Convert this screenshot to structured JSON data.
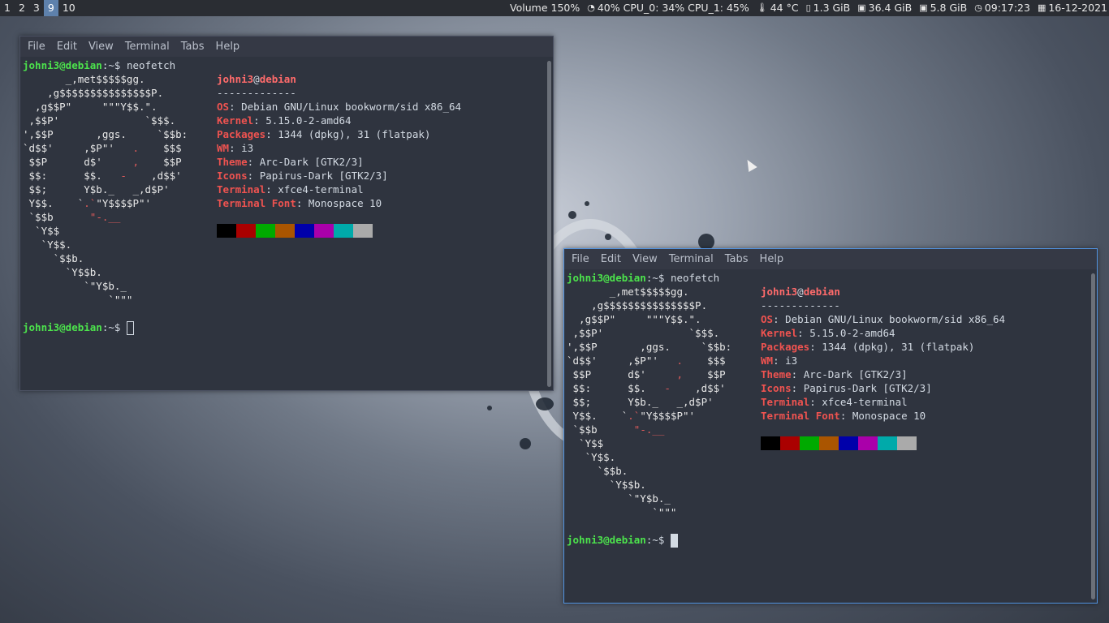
{
  "topbar": {
    "workspaces": [
      {
        "label": "1",
        "active": false
      },
      {
        "label": "2",
        "active": false
      },
      {
        "label": "3",
        "active": false
      },
      {
        "label": "9",
        "active": true
      },
      {
        "label": "10",
        "active": false
      }
    ],
    "volume": "Volume 150%",
    "cpu": "40% CPU_0: 34% CPU_1: 45%",
    "temp": "44 °C",
    "mem": "1.3 GiB",
    "disk1": "36.4 GiB",
    "disk2": "5.8 GiB",
    "time": "09:17:23",
    "date": "16-12-2021"
  },
  "terminal": {
    "menu": [
      "File",
      "Edit",
      "View",
      "Terminal",
      "Tabs",
      "Help"
    ],
    "user": "johni3@debian",
    "path_prompt": ":~$ ",
    "command": "neofetch",
    "header_user": "johni3",
    "header_at": "@",
    "header_host": "debian",
    "separator": "-------------",
    "info": [
      {
        "label": "OS",
        "value": ": Debian GNU/Linux bookworm/sid x86_64"
      },
      {
        "label": "Kernel",
        "value": ": 5.15.0-2-amd64"
      },
      {
        "label": "Packages",
        "value": ": 1344 (dpkg), 31 (flatpak)"
      },
      {
        "label": "WM",
        "value": ": i3"
      },
      {
        "label": "Theme",
        "value": ": Arc-Dark [GTK2/3]"
      },
      {
        "label": "Icons",
        "value": ": Papirus-Dark [GTK2/3]"
      },
      {
        "label": "Terminal",
        "value": ": xfce4-terminal"
      },
      {
        "label": "Terminal Font",
        "value": ": Monospace 10"
      }
    ],
    "palette": [
      "#000000",
      "#aa0000",
      "#00aa00",
      "#aa5500",
      "#0000aa",
      "#aa00aa",
      "#00aaaa",
      "#aaaaaa"
    ],
    "logo": [
      "       _,met$$$$$gg.",
      "    ,g$$$$$$$$$$$$$$$P.",
      "  ,g$$P\"     \"\"\"Y$$.\".",
      " ,$$P'              `$$$.",
      "',$$P       ,ggs.     `$$b:",
      "`d$$'     ,$P\"'   .    $$$",
      " $$P      d$'     ,    $$P",
      " $$:      $$.   -    ,d$$'",
      " $$;      Y$b._   _,d$P'",
      " Y$$.    `.`\"Y$$$$P\"'",
      " `$$b      \"-.__",
      "  `Y$$",
      "   `Y$$.",
      "     `$$b.",
      "       `Y$$b.",
      "          `\"Y$b._",
      "              `\"\"\""
    ]
  }
}
